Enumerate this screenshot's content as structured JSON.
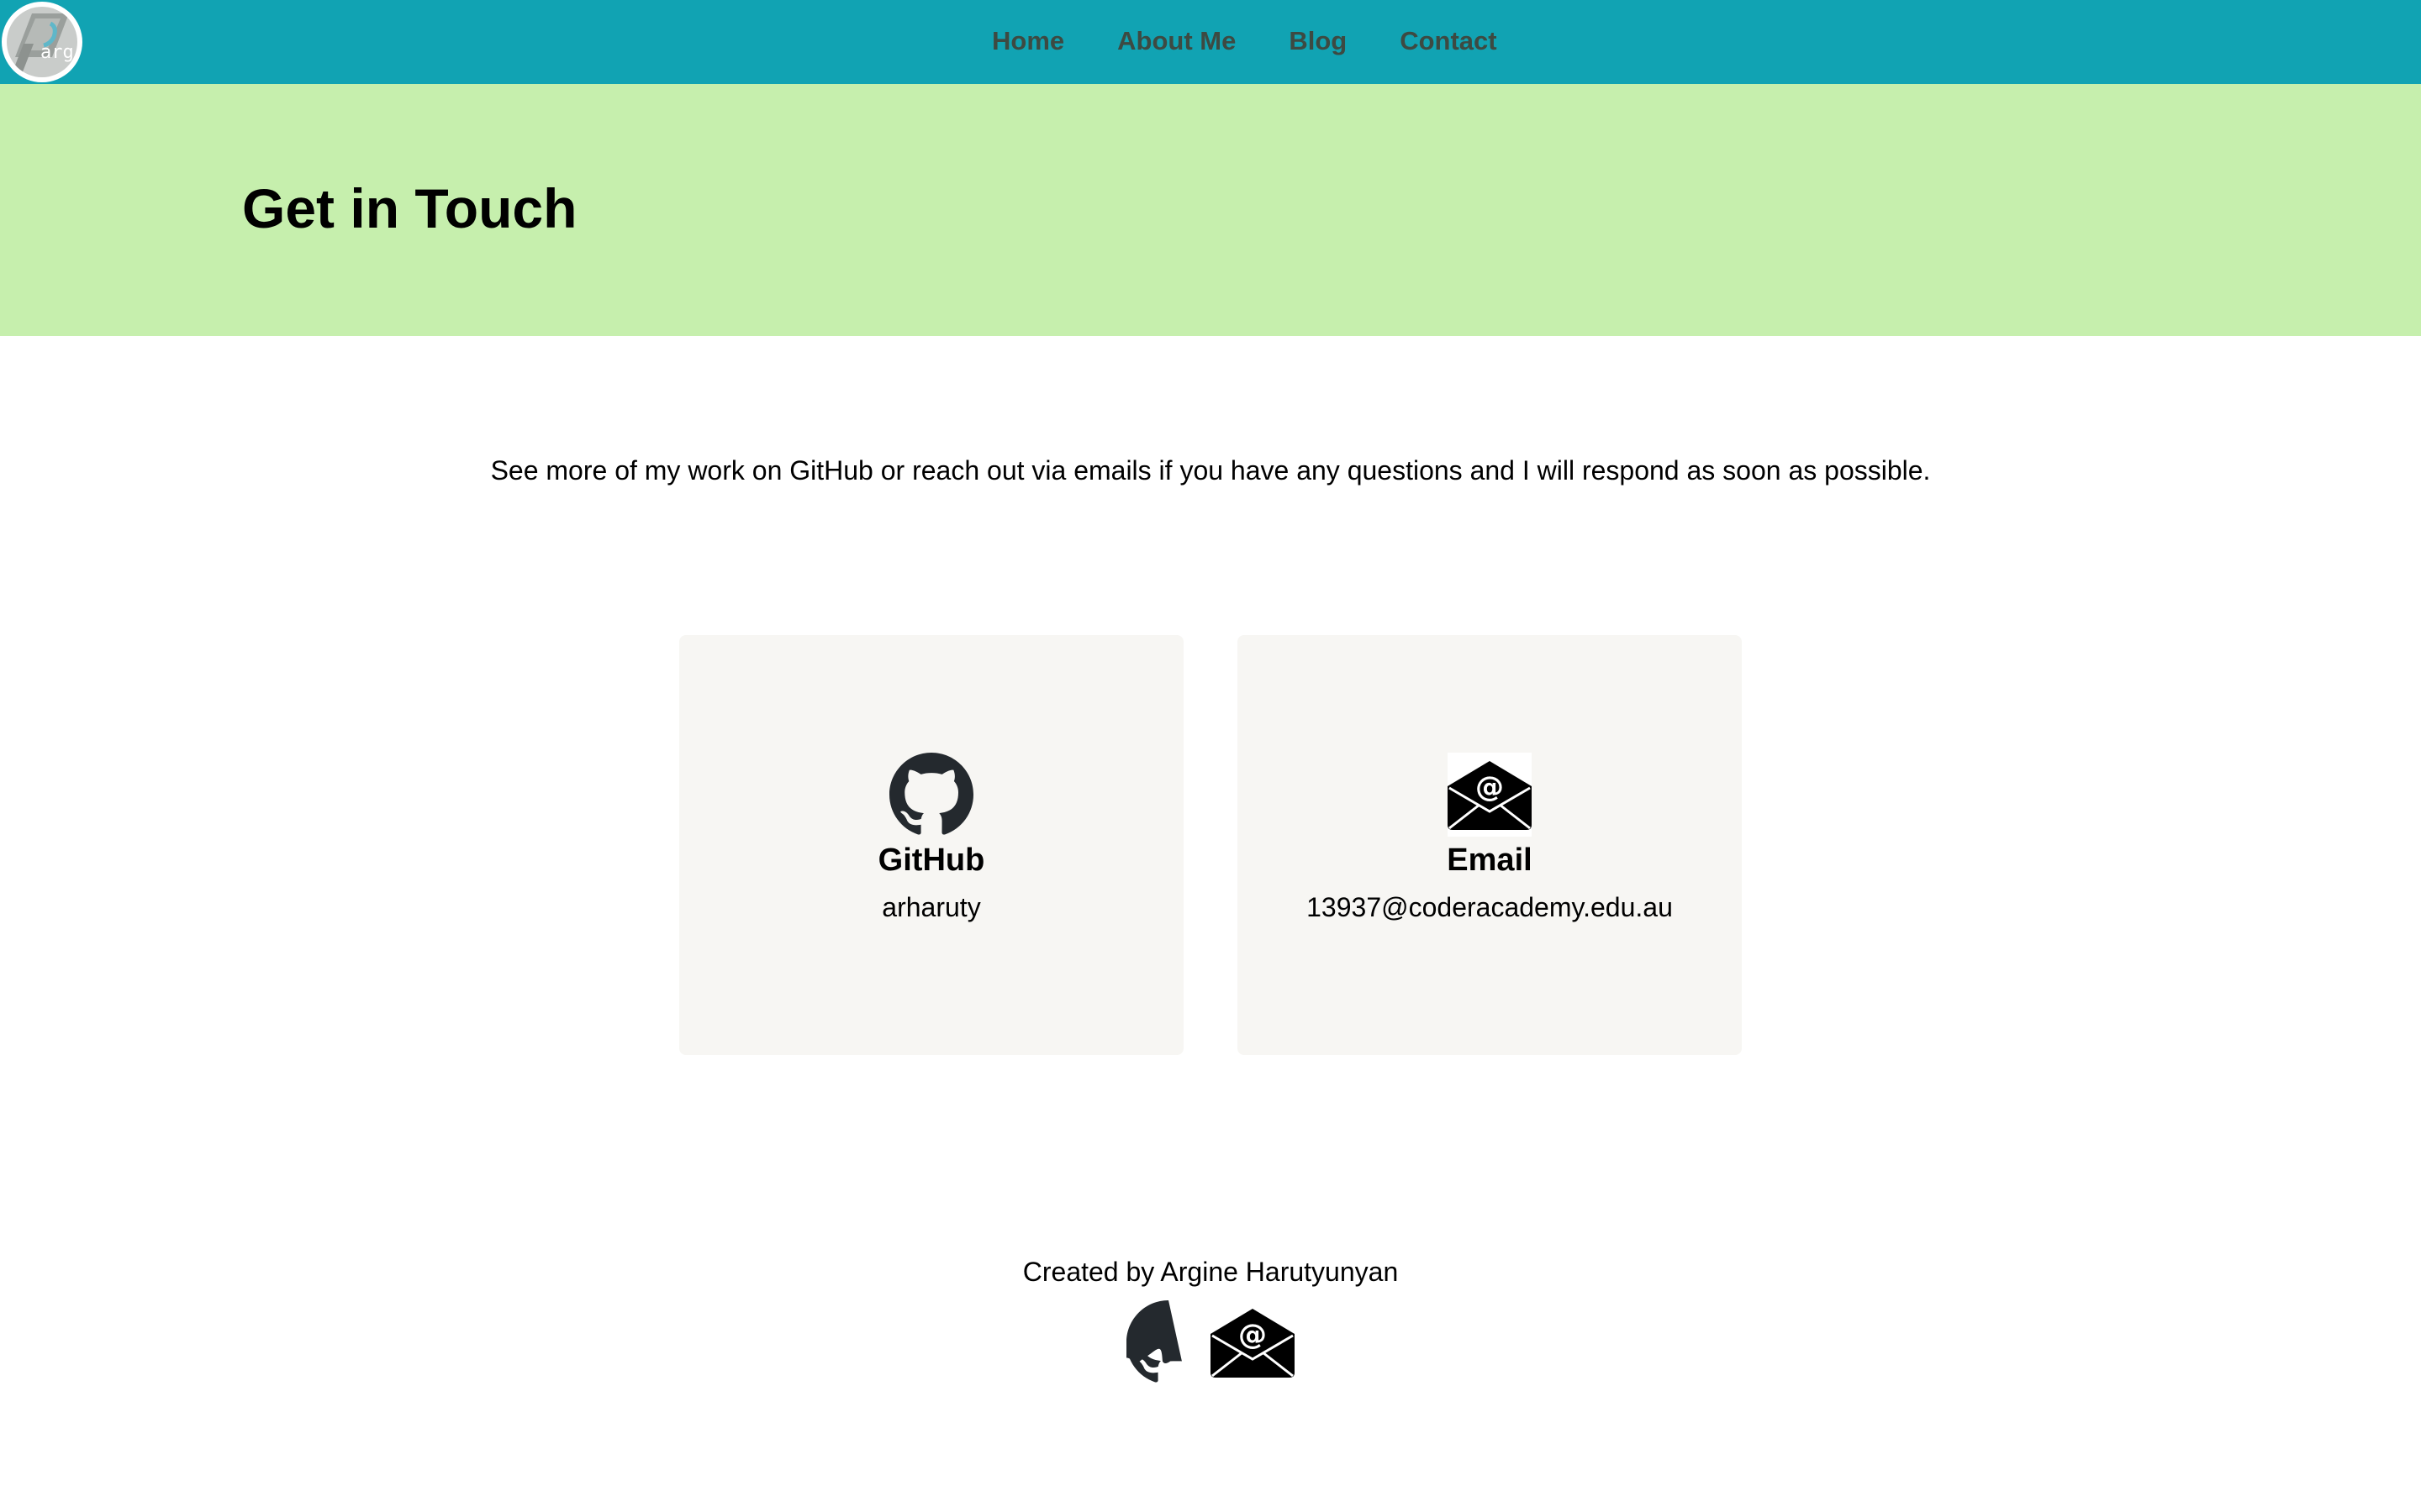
{
  "navbar": {
    "logo_text": "arg",
    "links": [
      {
        "label": "Home"
      },
      {
        "label": "About Me"
      },
      {
        "label": "Blog"
      },
      {
        "label": "Contact"
      }
    ],
    "background": "#11a3b3"
  },
  "hero": {
    "title": "Get in Touch",
    "background": "#c6efad"
  },
  "intro": {
    "text": "See more of my work on GitHub or reach out via emails if you have any questions and I will respond as soon as possible."
  },
  "cards": [
    {
      "icon": "github-icon",
      "title": "GitHub",
      "value": "arharuty"
    },
    {
      "icon": "email-icon",
      "title": "Email",
      "value": "13937@coderacademy.edu.au"
    }
  ],
  "footer": {
    "credit": "Created by Argine Harutyunyan",
    "icons": [
      "github-icon",
      "email-icon"
    ]
  }
}
